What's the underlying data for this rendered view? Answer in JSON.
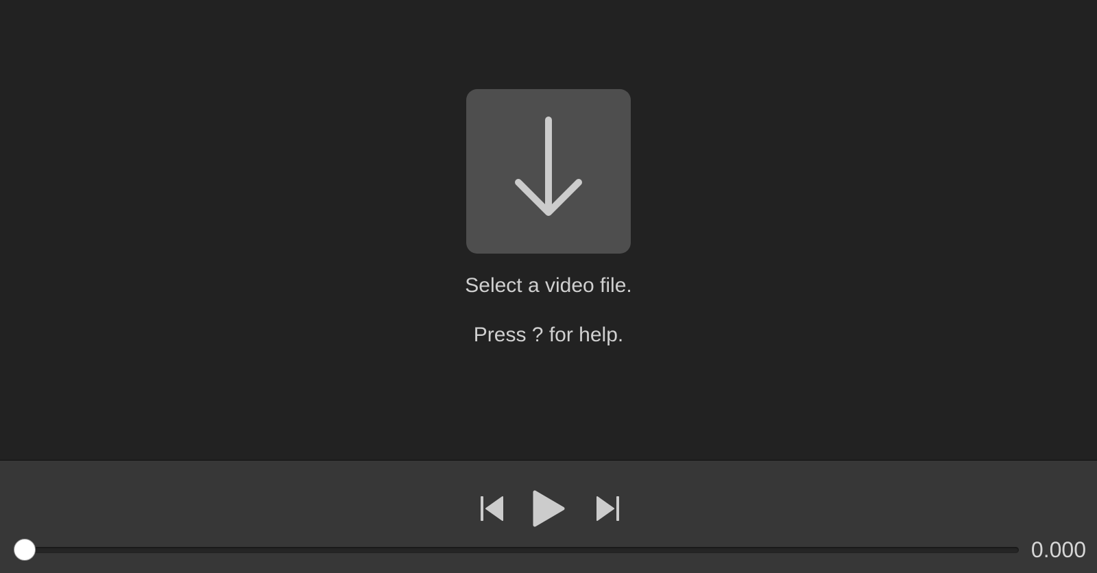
{
  "stage": {
    "drop_icon": "arrow-down-icon",
    "select_message": "Select a video file.",
    "help_message": "Press ? for help."
  },
  "controls": {
    "prev_icon": "skip-previous-icon",
    "play_icon": "play-icon",
    "next_icon": "skip-next-icon",
    "seek_position_fraction": 0,
    "time": "0.000"
  },
  "colors": {
    "background": "#222222",
    "drop_box": "#4e4e4e",
    "controls_bar": "#373737",
    "icon": "#cccccc",
    "text": "#d0d0d0"
  }
}
